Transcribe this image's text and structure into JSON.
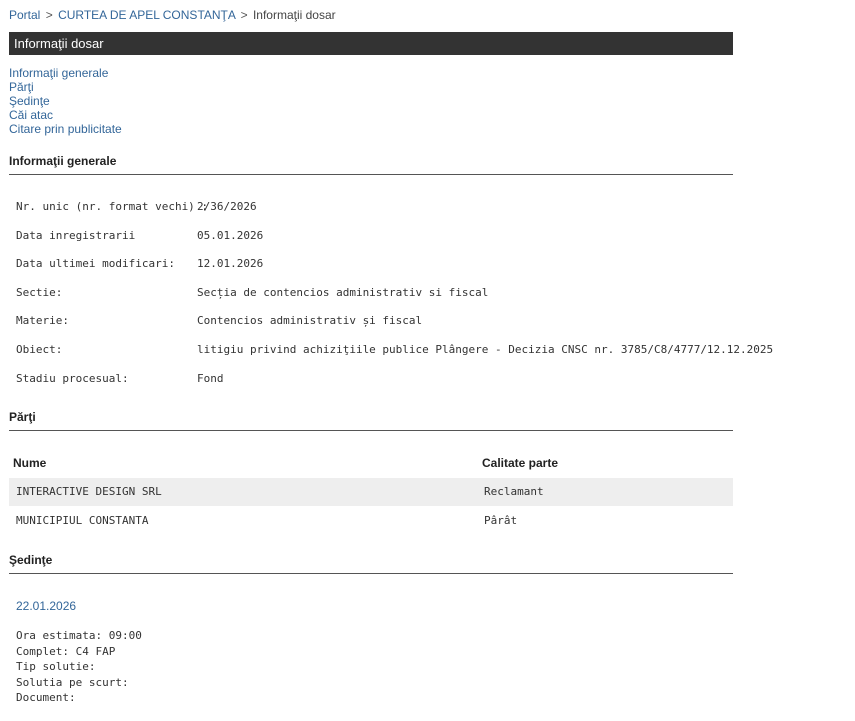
{
  "breadcrumb": {
    "portal": "Portal",
    "sep1": ">",
    "court": "CURTEA DE APEL CONSTANŢA",
    "sep2": ">",
    "current": "Informaţii dosar"
  },
  "title": "Informaţii dosar",
  "nav": [
    "Informaţii generale",
    "Părţi",
    "Şedinţe",
    "Căi atac",
    "Citare prin publicitate"
  ],
  "sections": {
    "general": "Informaţii generale",
    "parties": "Părţi",
    "hearings": "Şedinţe"
  },
  "general_info": [
    {
      "label": "Nr. unic (nr. format vechi) :",
      "value": "2/36/2026"
    },
    {
      "label": "Data inregistrarii",
      "value": "05.01.2026"
    },
    {
      "label": "Data ultimei modificari:",
      "value": "12.01.2026"
    },
    {
      "label": "Sectie:",
      "value": "Secția de contencios administrativ si fiscal"
    },
    {
      "label": "Materie:",
      "value": "Contencios administrativ și fiscal"
    },
    {
      "label": "Obiect:",
      "value": "litigiu privind achiziţiile publice Plângere - Decizia CNSC nr. 3785/C8/4777/12.12.2025"
    },
    {
      "label": "Stadiu procesual:",
      "value": "Fond"
    }
  ],
  "parties": {
    "headers": {
      "name": "Nume",
      "role": "Calitate parte"
    },
    "rows": [
      {
        "name": "INTERACTIVE DESIGN SRL",
        "role": "Reclamant"
      },
      {
        "name": "MUNICIPIUL CONSTANTA",
        "role": "Pârât"
      }
    ]
  },
  "hearing": {
    "date": "22.01.2026",
    "lines": [
      "Ora estimata: 09:00",
      "Complet: C4 FAP",
      "Tip solutie:",
      "Solutia pe scurt:",
      "Document:"
    ]
  }
}
